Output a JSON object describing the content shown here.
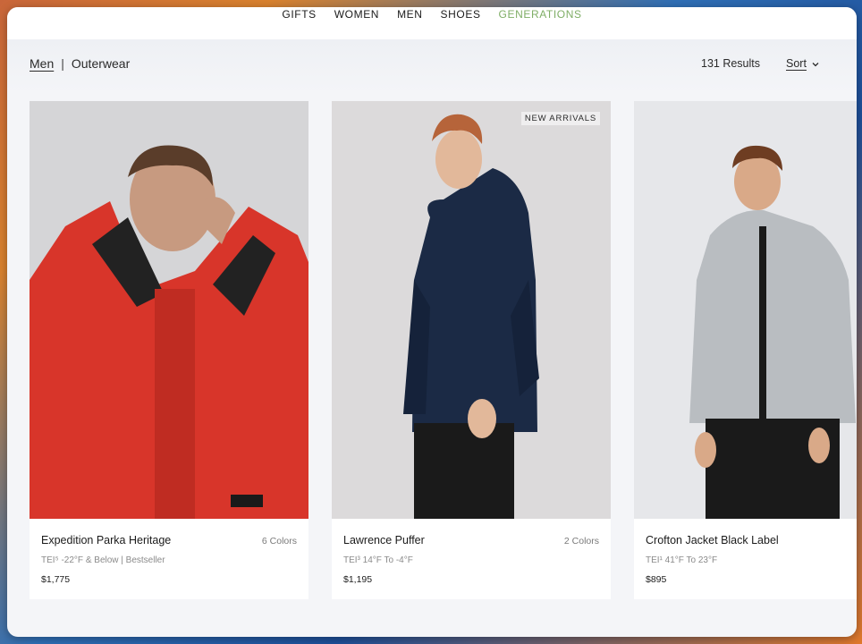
{
  "nav": {
    "items": [
      {
        "label": "GIFTS"
      },
      {
        "label": "WOMEN"
      },
      {
        "label": "MEN"
      },
      {
        "label": "SHOES"
      },
      {
        "label": "GENERATIONS",
        "color": "#7fae66"
      }
    ]
  },
  "breadcrumb": {
    "parent": "Men",
    "separator": "|",
    "current": "Outerwear"
  },
  "results": {
    "count_text": "131 Results"
  },
  "sort": {
    "label": "Sort"
  },
  "products": [
    {
      "name": "Expedition Parka Heritage",
      "colors": "6 Colors",
      "tei": "TEI⁵ -22°F & Below | Bestseller",
      "price": "$1,775",
      "badge": "",
      "jacket_color": "#d8352a"
    },
    {
      "name": "Lawrence Puffer",
      "colors": "2 Colors",
      "tei": "TEI³ 14°F To -4°F",
      "price": "$1,195",
      "badge": "NEW ARRIVALS",
      "jacket_color": "#1b2a45"
    },
    {
      "name": "Crofton Jacket Black Label",
      "colors": "",
      "tei": "TEI¹ 41°F To 23°F",
      "price": "$895",
      "badge": "",
      "jacket_color": "#b9bdc1"
    }
  ]
}
